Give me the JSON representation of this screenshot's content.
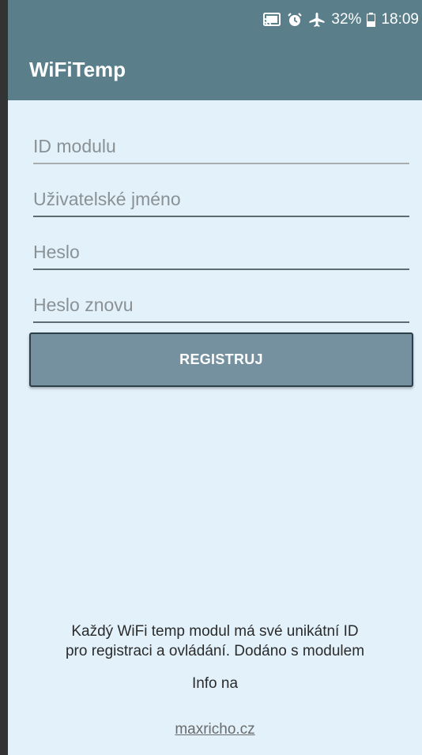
{
  "status_bar": {
    "battery": "32%",
    "time": "18:09",
    "icons": [
      "cast-icon",
      "alarm-icon",
      "airplane-icon",
      "battery-icon"
    ]
  },
  "app_bar": {
    "title": "WiFiTemp"
  },
  "form": {
    "module_id_placeholder": "ID modulu",
    "username_placeholder": "Uživatelské jméno",
    "password_placeholder": "Heslo",
    "password_again_placeholder": "Heslo znovu",
    "register_label": "REGISTRUJ"
  },
  "footer": {
    "description_line1": "Každý WiFi temp modul má své unikátní ID",
    "description_line2": "pro registraci a ovládání. Dodáno s modulem",
    "info_label": "Info na",
    "link": "maxricho.cz"
  },
  "colors": {
    "primary": "#5a7f8b",
    "background": "#e3f1fb",
    "button": "#7591a0"
  }
}
